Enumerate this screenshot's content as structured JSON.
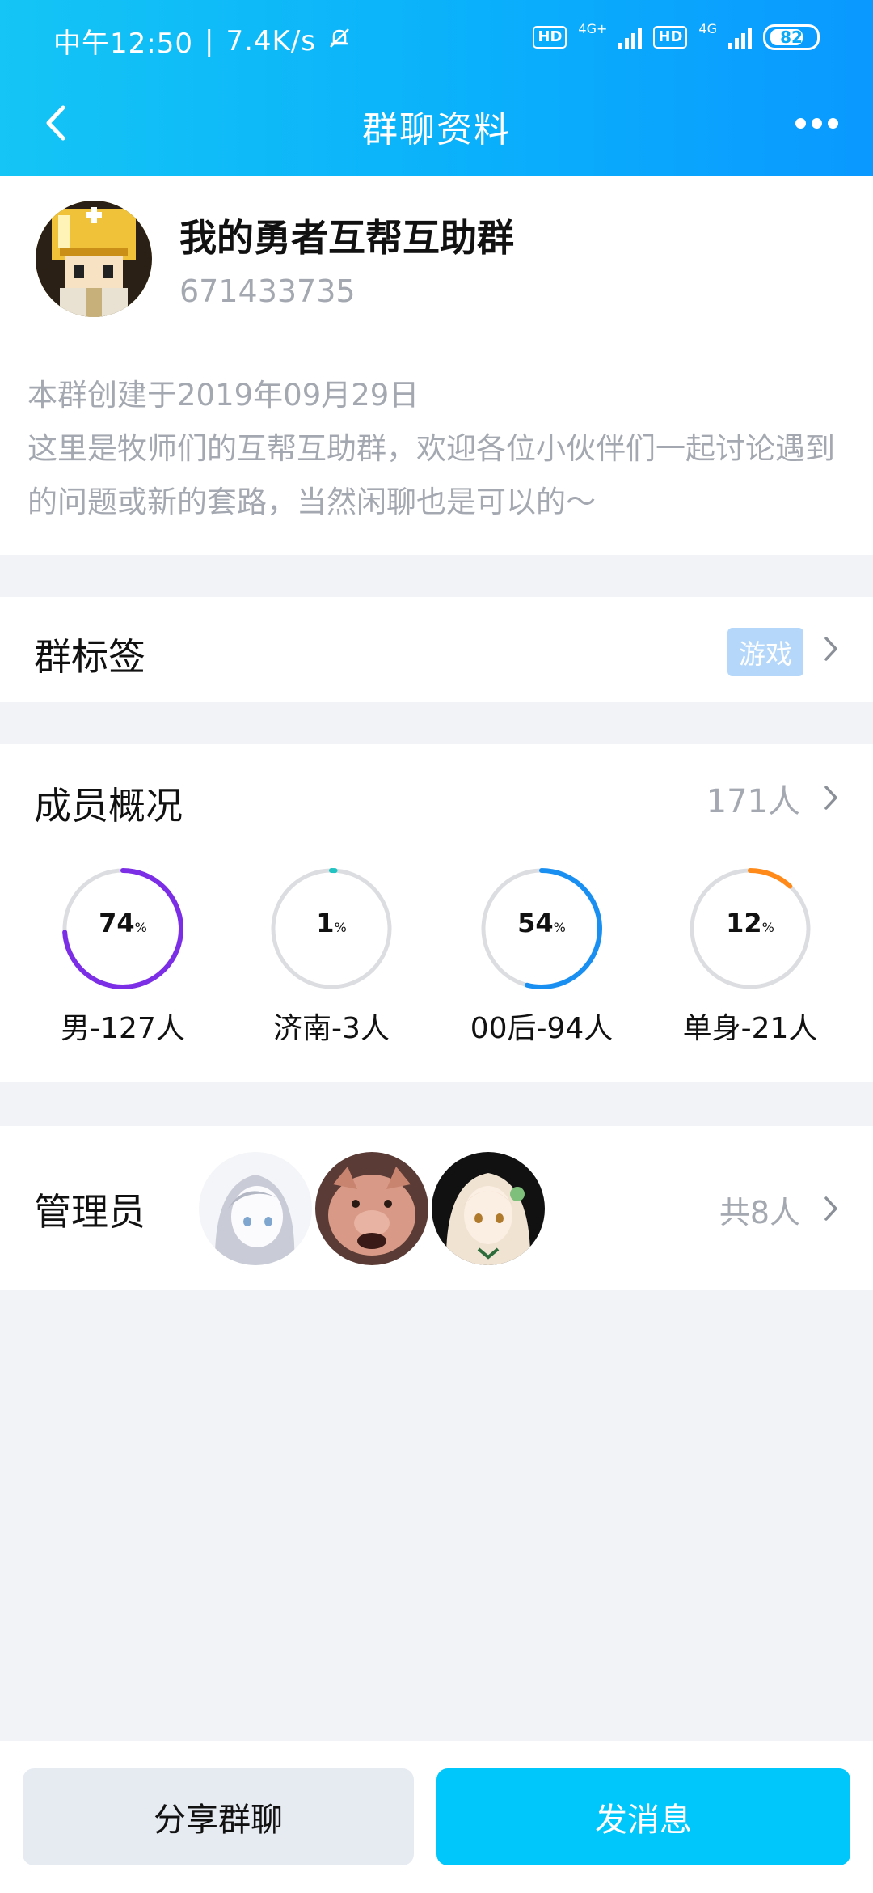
{
  "status_bar": {
    "time": "中午12:50",
    "speed": "7.4K/s",
    "hd1": "HD",
    "net1": "4G+",
    "hd2": "HD",
    "net2": "4G",
    "battery": "82"
  },
  "navbar": {
    "title": "群聊资料",
    "back_icon": "chevron-left-icon",
    "more_icon": "more-horizontal-icon"
  },
  "group": {
    "name": "我的勇者互帮互助群",
    "id": "671433735",
    "description": "本群创建于2019年09月29日\n这里是牧师们的互帮互助群，欢迎各位小伙伴们一起讨论遇到的问题或新的套路，当然闲聊也是可以的～"
  },
  "tags": {
    "label": "群标签",
    "chip": "游戏"
  },
  "members": {
    "label": "成员概况",
    "count": "171人",
    "stats": [
      {
        "value": "74",
        "unit": "%",
        "label": "男-127人",
        "percent": 74,
        "color": "#7b2ee6"
      },
      {
        "value": "1",
        "unit": "%",
        "label": "济南-3人",
        "percent": 1,
        "color": "#22c3c3"
      },
      {
        "value": "54",
        "unit": "%",
        "label": "00后-94人",
        "percent": 54,
        "color": "#1a8ff2"
      },
      {
        "value": "12",
        "unit": "%",
        "label": "单身-21人",
        "percent": 12,
        "color": "#ff8a1a"
      }
    ]
  },
  "admins": {
    "label": "管理员",
    "total": "共8人"
  },
  "actions": {
    "share": "分享群聊",
    "send": "发消息"
  }
}
